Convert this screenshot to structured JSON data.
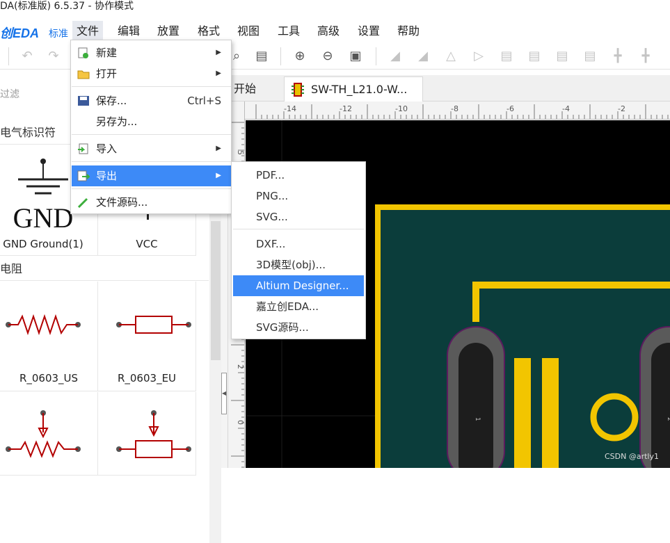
{
  "window": {
    "title": "DA(标准版) 6.5.37 - 协作模式"
  },
  "logo": {
    "text": "创EDA",
    "edition": "标准"
  },
  "menubar": {
    "items": [
      "文件",
      "编辑",
      "放置",
      "格式",
      "视图",
      "工具",
      "高级",
      "设置",
      "帮助"
    ],
    "active": "文件"
  },
  "toolbar": {
    "icons": [
      "undo-icon",
      "redo-icon",
      "search-tool-icon",
      "rubber-icon",
      "zoom-in-icon",
      "zoom-out-icon",
      "fit-icon",
      "align-left-icon",
      "align-right-icon",
      "flip-h-icon",
      "flip-v-icon",
      "align-top-icon",
      "align-bottom-icon",
      "align-center-icon",
      "distribute-icon",
      "distribute-v-icon"
    ]
  },
  "left_panel": {
    "filter_placeholder": "过滤",
    "cat_electrical": "电气标识符",
    "cat_resistor": "电阻",
    "cells": [
      {
        "label": "GND Ground(1)",
        "glyph": "GND"
      },
      {
        "label": "VCC"
      },
      {
        "label": "R_0603_US"
      },
      {
        "label": "R_0603_EU"
      }
    ]
  },
  "tabs": [
    {
      "label": "开始"
    },
    {
      "label": "SW-TH_L21.0-W..."
    }
  ],
  "ruler": {
    "top_ticks": [
      "-14",
      "-12",
      "-10",
      "-8",
      "-6",
      "-4",
      "-2"
    ],
    "left_ticks": [
      "5",
      "2",
      "0"
    ]
  },
  "file_menu": {
    "items": [
      {
        "label": "新建",
        "submenu": true,
        "icon": "new-file-icon"
      },
      {
        "label": "打开",
        "submenu": true,
        "icon": "open-folder-icon"
      },
      {
        "label": "保存...",
        "shortcut": "Ctrl+S",
        "icon": "save-icon"
      },
      {
        "label": "另存为..."
      },
      {
        "label": "导入",
        "submenu": true,
        "icon": "import-icon"
      },
      {
        "label": "导出",
        "submenu": true,
        "icon": "export-icon",
        "highlighted": true
      },
      {
        "label": "文件源码...",
        "icon": "source-code-icon"
      }
    ]
  },
  "export_submenu": {
    "items": [
      "PDF...",
      "PNG...",
      "SVG...",
      "DXF...",
      "3D模型(obj)...",
      "Altium Designer...",
      "嘉立创EDA...",
      "SVG源码..."
    ],
    "highlighted": "Altium Designer..."
  },
  "canvas": {
    "pad_labels": [
      "1",
      "2"
    ]
  },
  "watermark": "CSDN @artly1",
  "colors": {
    "accent": "#3d8af7",
    "board": "#0b3d3b",
    "silk": "#f2c500",
    "pad_outline": "#5a5a5a",
    "resistor": "#b30000"
  }
}
